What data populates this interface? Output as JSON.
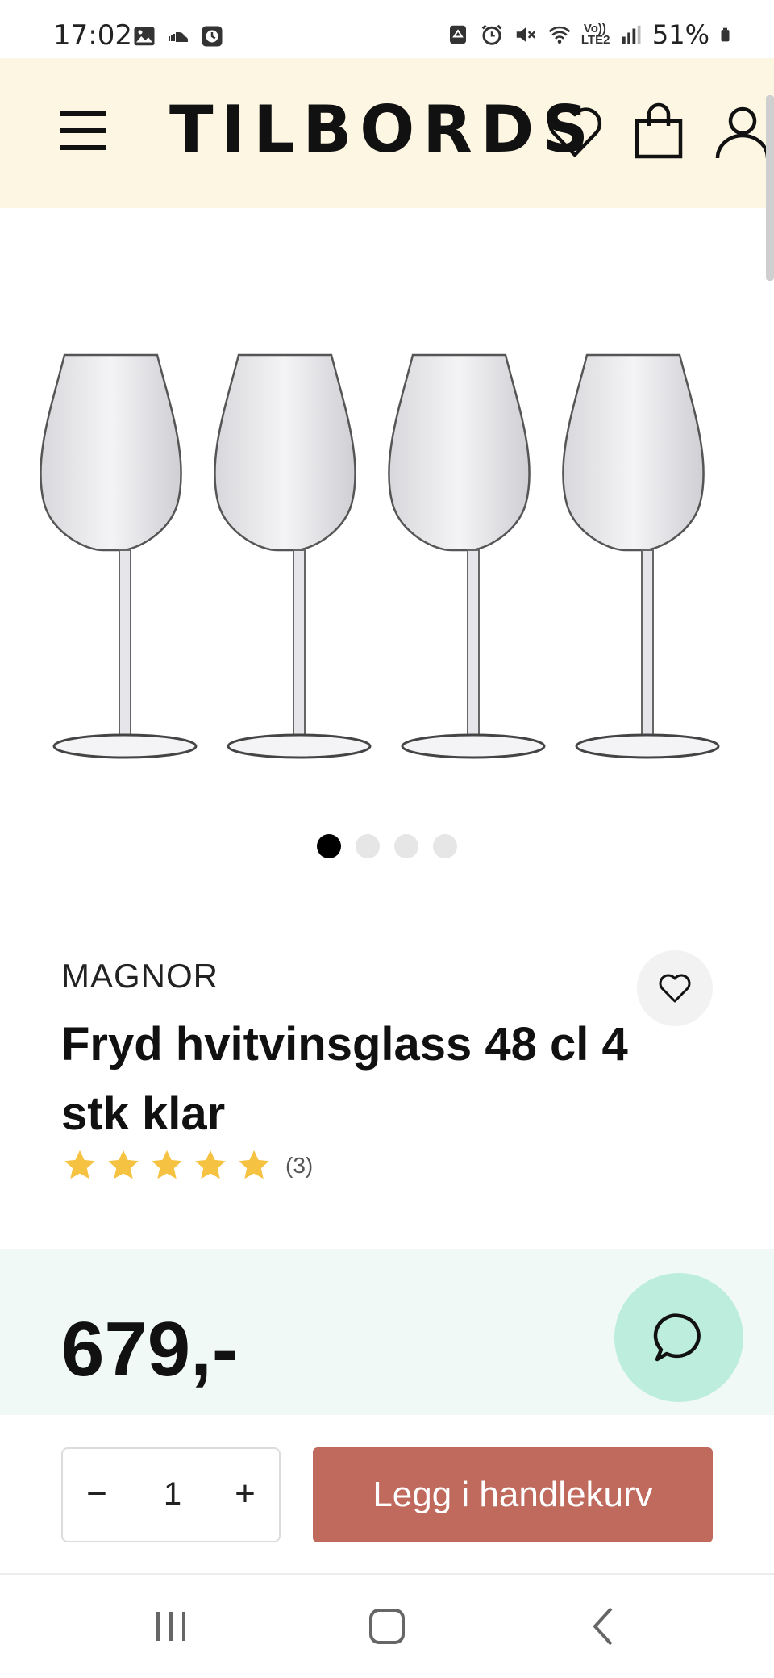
{
  "status_bar": {
    "time": "17:02",
    "battery": "51%",
    "network_label": "Vo)) LTE2",
    "left_icons": [
      "gallery-icon",
      "soundcloud-icon",
      "clock-app-icon"
    ],
    "right_icons": [
      "recycle-icon",
      "alarm-icon",
      "mute-icon",
      "wifi-icon",
      "signal-icon",
      "battery-icon"
    ]
  },
  "header": {
    "brand": "TILBORDS",
    "icons": [
      "menu-icon",
      "wishlist-icon",
      "cart-icon",
      "account-icon"
    ],
    "background": "#fdf6e3"
  },
  "carousel": {
    "image_icon": "wine-glasses-image",
    "slides": 4,
    "active_index": 0
  },
  "product": {
    "brand": "MAGNOR",
    "title": "Fryd hvitvinsglass 48 cl 4 stk klar",
    "rating_stars": 5,
    "review_count": "(3)",
    "price": "679,-"
  },
  "purchase": {
    "quantity": "1",
    "minus_label": "−",
    "plus_label": "+",
    "add_to_cart_label": "Legg i handlekurv"
  },
  "colors": {
    "cta": "#bf6a5c",
    "price_band": "#f1f9f6",
    "chat_bubble": "#bdeedd",
    "star": "#f5c242"
  },
  "nav": [
    "recents-icon",
    "home-icon",
    "back-icon"
  ]
}
